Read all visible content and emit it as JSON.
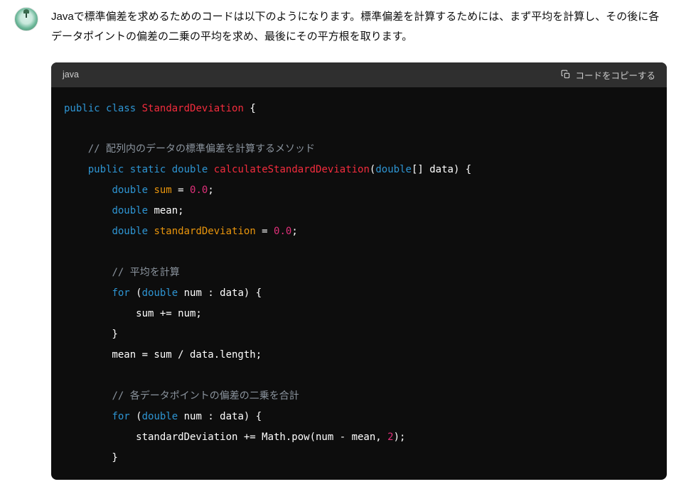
{
  "message": {
    "explanation": "Javaで標準偏差を求めるためのコードは以下のようになります。標準偏差を計算するためには、まず平均を計算し、その後に各データポイントの偏差の二乗の平均を求め、最後にその平方根を取ります。"
  },
  "codeblock": {
    "language": "java",
    "copy_label": "コードをコピーする",
    "tokens": {
      "kw_public": "public",
      "kw_class": "class",
      "kw_static": "static",
      "kw_for": "for",
      "type_double": "double",
      "type_double_arr": "double",
      "cls_StandardDeviation": "StandardDeviation",
      "fn_calculateStandardDeviation": "calculateStandardDeviation",
      "param_data": "data",
      "var_sum": "sum",
      "var_mean": "mean",
      "var_standardDeviation": "standardDeviation",
      "var_num": "num",
      "num_zero": "0.0",
      "num_two": "2",
      "prop_length": "length",
      "comment1": "// 配列内のデータの標準偏差を計算するメソッド",
      "comment2": "// 平均を計算",
      "comment3": "// 各データポイントの偏差の二乗を合計",
      "math_pow": "Math.pow"
    }
  }
}
